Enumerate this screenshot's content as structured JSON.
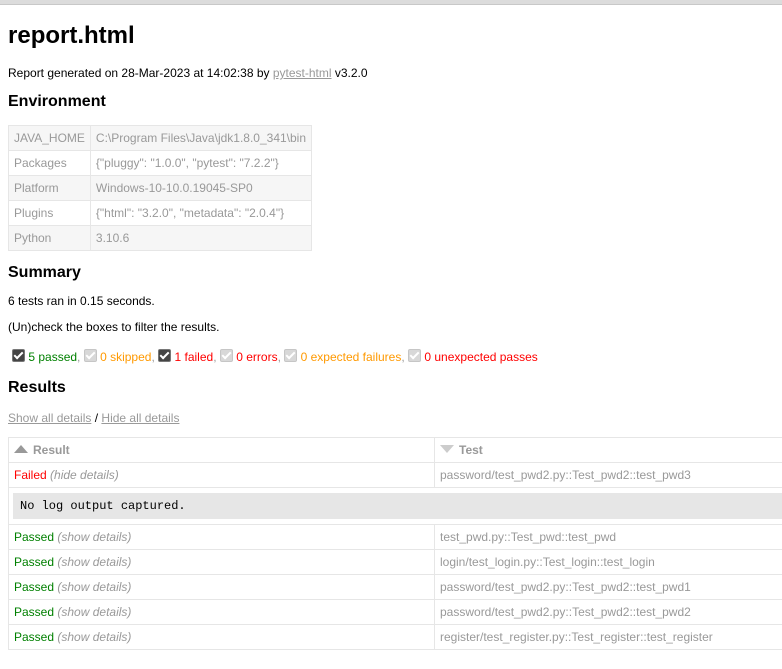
{
  "title": "report.html",
  "generated": {
    "prefix": "Report generated on 28-Mar-2023 at 14:02:38 by ",
    "link": "pytest-html",
    "suffix": " v3.2.0"
  },
  "environment": {
    "heading": "Environment",
    "rows": [
      {
        "key": "JAVA_HOME",
        "value": "C:\\Program Files\\Java\\jdk1.8.0_341\\bin"
      },
      {
        "key": "Packages",
        "value": "{\"pluggy\": \"1.0.0\", \"pytest\": \"7.2.2\"}"
      },
      {
        "key": "Platform",
        "value": "Windows-10-10.0.19045-SP0"
      },
      {
        "key": "Plugins",
        "value": "{\"html\": \"3.2.0\", \"metadata\": \"2.0.4\"}"
      },
      {
        "key": "Python",
        "value": "3.10.6"
      }
    ]
  },
  "summary": {
    "heading": "Summary",
    "ran": "6 tests ran in 0.15 seconds.",
    "hint": "(Un)check the boxes to filter the results.",
    "filters": [
      {
        "label": "5 passed",
        "checked": true,
        "enabled": true,
        "color": "#008000"
      },
      {
        "label": "0 skipped",
        "checked": true,
        "enabled": false,
        "color": "#ff9900"
      },
      {
        "label": "1 failed",
        "checked": true,
        "enabled": true,
        "color": "#ff0000"
      },
      {
        "label": "0 errors",
        "checked": true,
        "enabled": false,
        "color": "#ff0000"
      },
      {
        "label": "0 expected failures",
        "checked": true,
        "enabled": false,
        "color": "#ff9900"
      },
      {
        "label": "0 unexpected passes",
        "checked": true,
        "enabled": false,
        "color": "#ff0000"
      }
    ]
  },
  "results": {
    "heading": "Results",
    "show_all": "Show all details",
    "slash": " / ",
    "hide_all": "Hide all details",
    "col_result": "Result",
    "col_test": "Test",
    "rows": [
      {
        "result": "Failed",
        "details": "(hide details)",
        "test": "password/test_pwd2.py::Test_pwd2::test_pwd3"
      },
      {
        "result": "Passed",
        "details": "(show details)",
        "test": "test_pwd.py::Test_pwd::test_pwd"
      },
      {
        "result": "Passed",
        "details": "(show details)",
        "test": "login/test_login.py::Test_login::test_login"
      },
      {
        "result": "Passed",
        "details": "(show details)",
        "test": "password/test_pwd2.py::Test_pwd2::test_pwd1"
      },
      {
        "result": "Passed",
        "details": "(show details)",
        "test": "password/test_pwd2.py::Test_pwd2::test_pwd2"
      },
      {
        "result": "Passed",
        "details": "(show details)",
        "test": "register/test_register.py::Test_register::test_register"
      }
    ],
    "log": "No log output captured."
  },
  "colors": {
    "passed": "#008000",
    "failed": "#ff0000",
    "muted": "#999999"
  }
}
